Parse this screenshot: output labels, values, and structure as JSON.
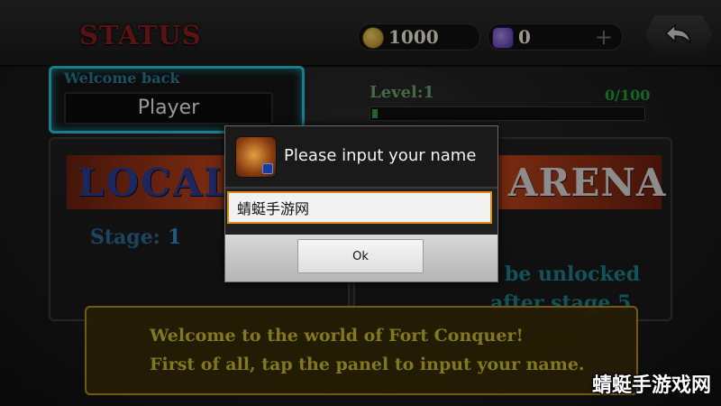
{
  "header": {
    "title": "STATUS",
    "gold": "1000",
    "gems": "0",
    "plus": "+"
  },
  "welcome": {
    "label": "Welcome back",
    "player_name": "Player"
  },
  "level": {
    "label": "Level:1",
    "progress_text": "0/100",
    "progress_fraction": 0.02
  },
  "local": {
    "title": "LOCAL",
    "stage_label": "Stage:",
    "stage_value": "1"
  },
  "arena": {
    "title": "ARENA",
    "note_line1": "l be unlocked",
    "note_line2": "after stage 5"
  },
  "message": {
    "line1": "Welcome to the world of Fort Conquer!",
    "line2": "First of all, tap the panel to input your name."
  },
  "dialog": {
    "title": "Please input your name",
    "input_value": "蜻蜓手游网",
    "ok_label": "Ok"
  },
  "watermark": "蜻蜓手游戏网",
  "colors": {
    "status_title": "#8a1e1e",
    "panel_border": "#27c2d6",
    "input_border": "#e08a1a",
    "message_text": "#c8bb2f"
  },
  "icons": {
    "gold": "coin-icon",
    "gems": "gem-icon",
    "back": "back-arrow-icon"
  }
}
